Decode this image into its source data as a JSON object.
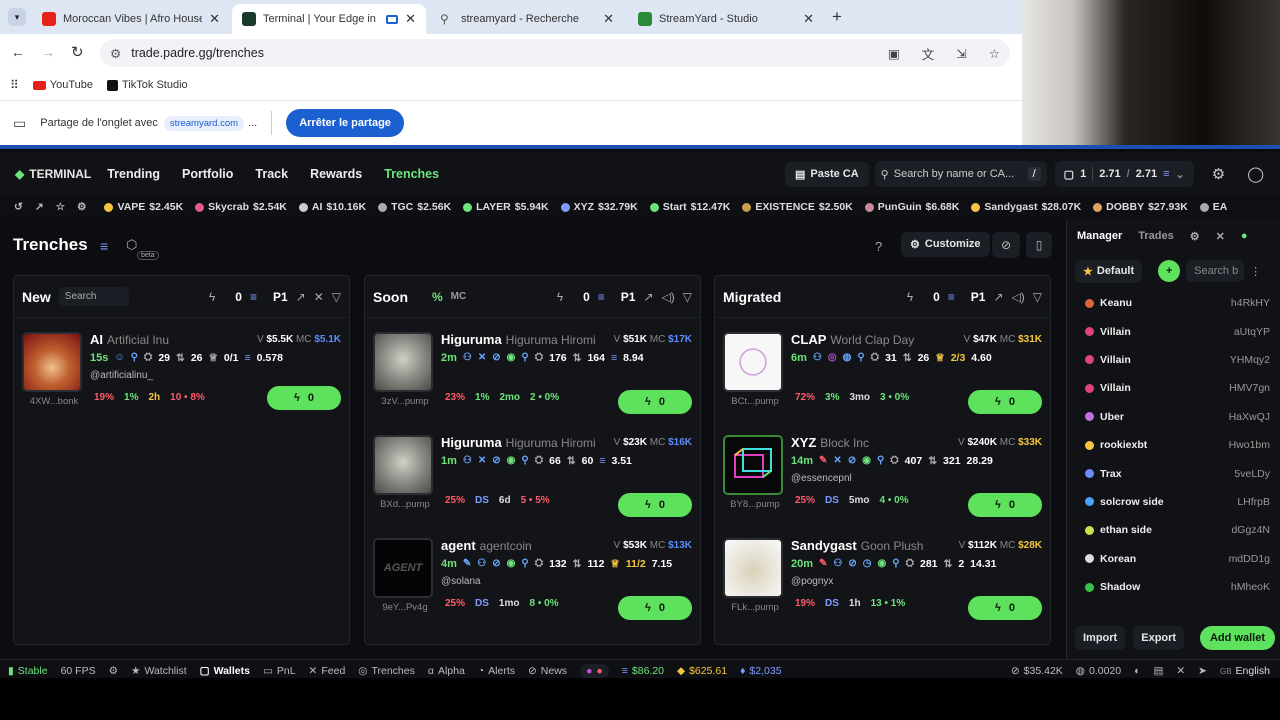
{
  "browser": {
    "tabs": [
      {
        "title": "Moroccan Vibes | Afro House C",
        "color": "#e62117"
      },
      {
        "title": "Terminal | Your Edge in Me",
        "color": "#1a3b2c"
      },
      {
        "title": "streamyard - Recherche",
        "color": "#888888"
      },
      {
        "title": "StreamYard - Studio",
        "color": "#2a8a3a"
      }
    ],
    "url": "trade.padre.gg/trenches",
    "bookmarks": [
      "YouTube",
      "TikTok Studio"
    ],
    "share_text": "Partage de l'onglet avec",
    "share_target": "streamyard.com",
    "share_more": "...",
    "stop_share": "Arrêter le partage"
  },
  "app": {
    "brand": "TERMINAL",
    "nav": [
      "Trending",
      "Portfolio",
      "Track",
      "Rewards",
      "Trenches"
    ],
    "paste_ca": "Paste CA",
    "search_placeholder": "Search by name or CA...",
    "search_shortcut": "/",
    "wallet_count": "1",
    "balance_a": "2.71",
    "balance_sep": "/",
    "balance_b": "2.71"
  },
  "ticker": [
    {
      "name": "VAPE",
      "mc": "$2.45K",
      "color": "#f5c542"
    },
    {
      "name": "Skycrab",
      "mc": "$2.54K",
      "color": "#e05a8a"
    },
    {
      "name": "AI",
      "mc": "$10.16K",
      "color": "#cccccc"
    },
    {
      "name": "TGC",
      "mc": "$2.56K",
      "color": "#aaaaaa"
    },
    {
      "name": "LAYER",
      "mc": "$5.94K",
      "color": "#6ee37a"
    },
    {
      "name": "XYZ",
      "mc": "$32.79K",
      "color": "#7e9cff"
    },
    {
      "name": "Start",
      "mc": "$12.47K",
      "color": "#6ee37a"
    },
    {
      "name": "EXISTENCE",
      "mc": "$2.50K",
      "color": "#c7a04a"
    },
    {
      "name": "PunGuin",
      "mc": "$6.68K",
      "color": "#cc8899"
    },
    {
      "name": "Sandygast",
      "mc": "$28.07K",
      "color": "#f5c542"
    },
    {
      "name": "DOBBY",
      "mc": "$27.93K",
      "color": "#e0a060"
    },
    {
      "name": "EA",
      "mc": "",
      "color": "#aaaaaa"
    }
  ],
  "page": {
    "title": "Trenches",
    "beta": "beta",
    "customize": "Customize"
  },
  "columns": [
    {
      "title": "New",
      "search": "Search",
      "count": "0",
      "preset": "P1",
      "percent": "",
      "mc": "",
      "cards": [
        {
          "symbol": "AI",
          "name": "Artificial Inu",
          "v": "$5.5K",
          "mc": "$5.1K",
          "age": "15s",
          "h1": "29",
          "h2": "26",
          "h3": "0/1",
          "h4": "0.578",
          "social": "@artificialinu_",
          "addr": "4XW...bonk",
          "p1": "19%",
          "p2": "1%",
          "p3": "2h",
          "p4": "10 • 8%",
          "buy": "0",
          "avatar": "#c44a1e"
        }
      ]
    },
    {
      "title": "Soon",
      "search": "",
      "count": "0",
      "preset": "P1",
      "percent": "%",
      "mc": "MC",
      "cards": [
        {
          "symbol": "Higuruma",
          "name": "Higuruma Hiromi",
          "v": "$51K",
          "mc": "$17K",
          "age": "2m",
          "h1": "176",
          "h2": "164",
          "h3": "",
          "h4": "8.94",
          "social": "",
          "addr": "3zV...pump",
          "p1": "23%",
          "p2": "1%",
          "p3": "2mo",
          "p4": "2 • 0%",
          "buy": "0",
          "avatar": "#8a8a84"
        },
        {
          "symbol": "Higuruma",
          "name": "Higuruma Hiromi",
          "v": "$23K",
          "mc": "$16K",
          "age": "1m",
          "h1": "66",
          "h2": "60",
          "h3": "",
          "h4": "3.51",
          "social": "",
          "addr": "BXd...pump",
          "p1": "25%",
          "p2": "DS",
          "p3": "6d",
          "p4": "5 • 5%",
          "buy": "0",
          "avatar": "#8a8a84"
        },
        {
          "symbol": "agent",
          "name": "agentcoin",
          "v": "$53K",
          "mc": "$13K",
          "age": "4m",
          "h1": "132",
          "h2": "112",
          "h3": "11/2",
          "h4": "7.15",
          "social": "@solana",
          "addr": "9eY...Pv4g",
          "p1": "25%",
          "p2": "DS",
          "p3": "1mo",
          "p4": "8 • 0%",
          "buy": "0",
          "avatar": "#0a0a0a"
        }
      ]
    },
    {
      "title": "Migrated",
      "search": "",
      "count": "0",
      "preset": "P1",
      "percent": "",
      "mc": "",
      "cards": [
        {
          "symbol": "CLAP",
          "name": "World Clap Day",
          "v": "$47K",
          "mc": "$31K",
          "age": "6m",
          "h1": "31",
          "h2": "26",
          "h3": "2/3",
          "h4": "4.60",
          "social": "",
          "addr": "BCt...pump",
          "p1": "72%",
          "p2": "3%",
          "p3": "3mo",
          "p4": "3 • 0%",
          "buy": "0",
          "avatar": "#f2f2f2"
        },
        {
          "symbol": "XYZ",
          "name": "Block Inc",
          "v": "$240K",
          "mc": "$33K",
          "age": "14m",
          "h1": "407",
          "h2": "321",
          "h3": "",
          "h4": "28.29",
          "social": "@essencepnl",
          "addr": "BY8...pump",
          "p1": "25%",
          "p2": "DS",
          "p3": "5mo",
          "p4": "4 • 0%",
          "buy": "0",
          "avatar": "#111111"
        },
        {
          "symbol": "Sandygast",
          "name": "Goon Plush",
          "v": "$112K",
          "mc": "$28K",
          "age": "20m",
          "h1": "281",
          "h2": "2",
          "h3": "",
          "h4": "14.31",
          "social": "@pognyx",
          "addr": "FLk...pump",
          "p1": "19%",
          "p2": "DS",
          "p3": "1h",
          "p4": "13 • 1%",
          "buy": "0",
          "avatar": "#e8e4d8"
        }
      ]
    }
  ],
  "sidebar": {
    "tabs": [
      "Manager",
      "Trades"
    ],
    "preset": "Default",
    "search": "Search b",
    "wallets": [
      {
        "name": "Keanu",
        "addr": "h4RkHY",
        "color": "#e0643a"
      },
      {
        "name": "Villain",
        "addr": "aUtqYP",
        "color": "#e0457a"
      },
      {
        "name": "Villain",
        "addr": "YHMqy2",
        "color": "#e0457a"
      },
      {
        "name": "Villain",
        "addr": "HMV7gn",
        "color": "#e0457a"
      },
      {
        "name": "Uber",
        "addr": "HaXwQJ",
        "color": "#c070e0"
      },
      {
        "name": "rookiexbt",
        "addr": "Hwo1bm",
        "color": "#f5c542"
      },
      {
        "name": "Trax",
        "addr": "5veLDy",
        "color": "#6a8cff"
      },
      {
        "name": "solcrow side",
        "addr": "LHfrpB",
        "color": "#4aa0ff"
      },
      {
        "name": "ethan side",
        "addr": "dGgz4N",
        "color": "#c8e04a"
      },
      {
        "name": "Korean",
        "addr": "mdDD1g",
        "color": "#dddddd"
      },
      {
        "name": "Shadow",
        "addr": "hMheoK",
        "color": "#3ac04a"
      }
    ],
    "import": "Import",
    "export": "Export",
    "add_wallet": "Add wallet"
  },
  "status": {
    "stable": "Stable",
    "fps": "60 FPS",
    "items": [
      "Watchlist",
      "Wallets",
      "PnL",
      "Feed",
      "Trenches",
      "Alpha",
      "Alerts",
      "News"
    ],
    "sol": "$86.20",
    "bnb": "$625.61",
    "eth": "$2,035",
    "vol": "$35.42K",
    "fee": "0.0020",
    "lang_code": "GB",
    "lang": "English"
  }
}
